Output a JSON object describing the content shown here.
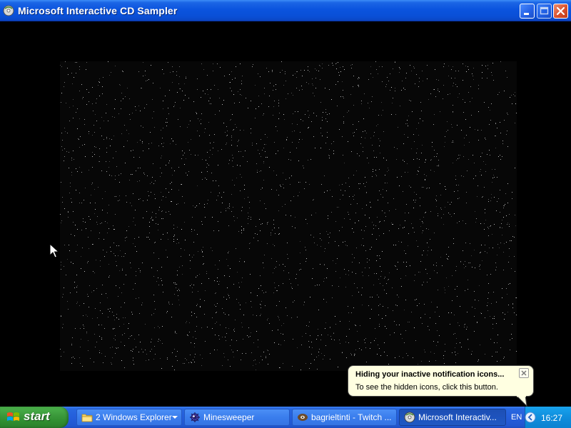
{
  "window": {
    "title": "Microsoft Interactive CD Sampler"
  },
  "balloon": {
    "title": "Hiding your inactive notification icons...",
    "text": "To see the hidden icons, click this button."
  },
  "taskbar": {
    "start_label": "start",
    "tasks": [
      {
        "label": "2 Windows Explorer",
        "icon": "folder-icon"
      },
      {
        "label": "Minesweeper",
        "icon": "minesweeper-icon"
      },
      {
        "label": "bagrieltinti - Twitch ...",
        "icon": "twitch-icon"
      },
      {
        "label": "Microsoft Interactiv...",
        "icon": "cd-sampler-icon"
      }
    ],
    "language": "EN",
    "clock": "16:27"
  },
  "colors": {
    "titlebar": "#0a4fd6",
    "taskbar": "#245edb",
    "start_button": "#3c9a3c",
    "tray": "#0f8ddc",
    "balloon": "#ffffe1"
  }
}
